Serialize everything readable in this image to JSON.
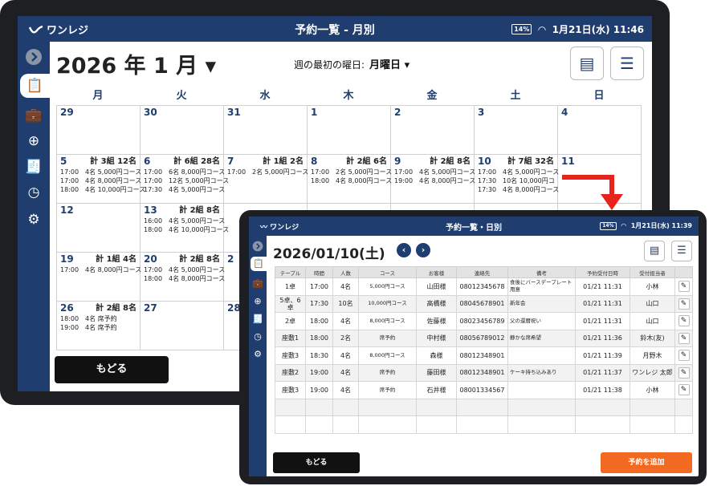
{
  "app": {
    "logo_text": "ワンレジ",
    "status_time": "1月21日(水) 11:46",
    "battery": "14%"
  },
  "monthly": {
    "title": "予約一覧 - 月別",
    "month_label": "2026 年 1 月 ▾",
    "week_start_label": "週の最初の曜日:",
    "week_start_value": "月曜日 ▾",
    "weekdays": [
      "月",
      "火",
      "水",
      "木",
      "金",
      "土",
      "日"
    ],
    "weeks": [
      [
        {
          "day": "29"
        },
        {
          "day": "30"
        },
        {
          "day": "31"
        },
        {
          "day": "1"
        },
        {
          "day": "2"
        },
        {
          "day": "3"
        },
        {
          "day": "4"
        }
      ],
      [
        {
          "day": "5",
          "total": "計 3組 12名",
          "lines": [
            "17:00　4名 5,000円コース",
            "17:00　4名 8,000円コース",
            "18:00　4名 10,000円コース"
          ]
        },
        {
          "day": "6",
          "total": "計 6組 28名",
          "lines": [
            "17:00　6名 8,000円コース",
            "17:00　12名 5,000円コース",
            "17:30　4名 5,000円コース"
          ]
        },
        {
          "day": "7",
          "total": "計 1組 2名",
          "lines": [
            "17:00　2名 5,000円コース"
          ]
        },
        {
          "day": "8",
          "total": "計 2組 6名",
          "lines": [
            "17:00　2名 5,000円コース",
            "18:00　4名 8,000円コース"
          ]
        },
        {
          "day": "9",
          "total": "計 2組 8名",
          "lines": [
            "17:00　4名 5,000円コース",
            "19:00　4名 8,000円コース"
          ]
        },
        {
          "day": "10",
          "total": "計 7組 32名",
          "lines": [
            "17:00　4名 5,000円コース",
            "17:30　10名 10,000円コ",
            "17:30　4名 8,000円コース"
          ]
        },
        {
          "day": "11"
        }
      ],
      [
        {
          "day": "12"
        },
        {
          "day": "13",
          "total": "計 2組 8名",
          "lines": [
            "16:00　4名 5,000円コース",
            "18:00　4名 10,000円コース"
          ]
        },
        {
          "day": ""
        },
        {
          "day": ""
        },
        {
          "day": ""
        },
        {
          "day": ""
        },
        {
          "day": ""
        }
      ],
      [
        {
          "day": "19",
          "total": "計 1組 4名",
          "lines": [
            "17:00　4名 8,000円コース"
          ]
        },
        {
          "day": "20",
          "total": "計 2組 8名",
          "lines": [
            "17:00　4名 5,000円コース",
            "18:00　4名 8,000円コース"
          ]
        },
        {
          "day": "2"
        },
        {
          "day": ""
        },
        {
          "day": ""
        },
        {
          "day": ""
        },
        {
          "day": ""
        }
      ],
      [
        {
          "day": "26",
          "total": "計 2組 8名",
          "lines": [
            "18:00　4名 席予約",
            "19:00　4名 席予約"
          ]
        },
        {
          "day": "27"
        },
        {
          "day": "28"
        },
        {
          "day": ""
        },
        {
          "day": ""
        },
        {
          "day": ""
        },
        {
          "day": ""
        }
      ]
    ],
    "back_label": "もどる"
  },
  "daily": {
    "title": "予約一覧・日別",
    "status_time": "1月21日(水) 11:39",
    "date_label": "2026/01/10(土)",
    "columns": [
      "テーブル",
      "時間",
      "人数",
      "コース",
      "お客様",
      "連絡先",
      "備考",
      "予約受付日時",
      "受付担当者",
      ""
    ],
    "rows": [
      [
        "1卓",
        "17:00",
        "4名",
        "5,000円コース",
        "山田様",
        "08012345678",
        "食後にバースデープレート用意",
        "01/21 11:31",
        "小林"
      ],
      [
        "5卓、6卓",
        "17:30",
        "10名",
        "10,000円コース",
        "高橋様",
        "08045678901",
        "新年会",
        "01/21 11:31",
        "山口"
      ],
      [
        "2卓",
        "18:00",
        "4名",
        "8,000円コース",
        "佐藤様",
        "08023456789",
        "父の還暦祝い",
        "01/21 11:31",
        "山口"
      ],
      [
        "座敷1",
        "18:00",
        "2名",
        "席予約",
        "中村様",
        "08056789012",
        "静かな席希望",
        "01/21 11:36",
        "鈴木(友)"
      ],
      [
        "座敷3",
        "18:30",
        "4名",
        "8,000円コース",
        "森様",
        "08012348901",
        "",
        "01/21 11:39",
        "月野木"
      ],
      [
        "座敷2",
        "19:00",
        "4名",
        "席予約",
        "藤田様",
        "08012348901",
        "ケーキ持ち込みあり",
        "01/21 11:37",
        "ワンレジ 太郎"
      ],
      [
        "座敷3",
        "19:00",
        "4名",
        "席予約",
        "石井様",
        "08001334567",
        "",
        "01/21 11:38",
        "小林"
      ]
    ],
    "back_label": "もどる",
    "add_label": "予約を追加"
  },
  "colors": {
    "navy": "#1f3d6e",
    "orange": "#f26a21",
    "arrow": "#e8231b"
  }
}
